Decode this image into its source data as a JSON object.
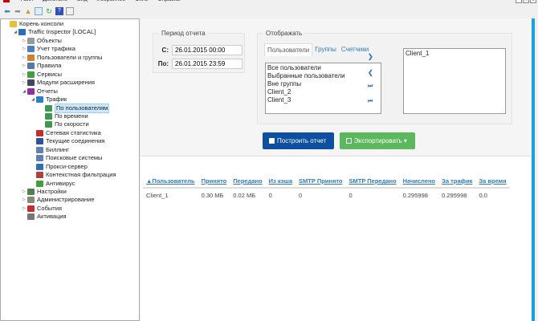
{
  "menu": [
    "Файл",
    "Действие",
    "Вид",
    "Избранное",
    "Окно",
    "Справка"
  ],
  "tree": [
    {
      "label": "Корень консоли",
      "level": 0,
      "arrow": "",
      "color": "#e8c040"
    },
    {
      "label": "Traffic Inspector [LOCAL]",
      "level": 1,
      "arrow": "◢",
      "color": "#2a6fb8"
    },
    {
      "label": "Объекты",
      "level": 2,
      "arrow": "▷",
      "color": "#999"
    },
    {
      "label": "Учет трафика",
      "level": 2,
      "arrow": "▷",
      "color": "#4a7fc0"
    },
    {
      "label": "Пользователи и группы",
      "level": 2,
      "arrow": "▷",
      "color": "#d08030"
    },
    {
      "label": "Правила",
      "level": 2,
      "arrow": "▷",
      "color": "#5577aa"
    },
    {
      "label": "Сервисы",
      "level": 2,
      "arrow": "▷",
      "color": "#40a040"
    },
    {
      "label": "Модули расширения",
      "level": 2,
      "arrow": "▷",
      "color": "#446"
    },
    {
      "label": "Отчеты",
      "level": 2,
      "arrow": "◢",
      "color": "#9030a0"
    },
    {
      "label": "Трафик",
      "level": 3,
      "arrow": "◢",
      "color": "#2a80c8"
    },
    {
      "label": "По пользователям",
      "level": 4,
      "arrow": "",
      "color": "#3a9a50",
      "selected": true
    },
    {
      "label": "По времени",
      "level": 4,
      "arrow": "",
      "color": "#3a9a50"
    },
    {
      "label": "По скорости",
      "level": 4,
      "arrow": "",
      "color": "#3a9a50"
    },
    {
      "label": "Сетевая статистика",
      "level": 3,
      "arrow": "",
      "color": "#c03030"
    },
    {
      "label": "Текущие соединения",
      "level": 3,
      "arrow": "",
      "color": "#3050a0"
    },
    {
      "label": "Биллинг",
      "level": 3,
      "arrow": "",
      "color": "#6080b0"
    },
    {
      "label": "Поисковые системы",
      "level": 3,
      "arrow": "",
      "color": "#6080b0"
    },
    {
      "label": "Прокси-сервер",
      "level": 3,
      "arrow": "",
      "color": "#3070b0"
    },
    {
      "label": "Контекстная фильтрация",
      "level": 3,
      "arrow": "",
      "color": "#b04040"
    },
    {
      "label": "Антивирус",
      "level": 3,
      "arrow": "",
      "color": "#40a040"
    },
    {
      "label": "Настройки",
      "level": 2,
      "arrow": "▷",
      "color": "#508050"
    },
    {
      "label": "Администрирование",
      "level": 2,
      "arrow": "▷",
      "color": "#887"
    },
    {
      "label": "События",
      "level": 2,
      "arrow": "▷",
      "color": "#c03030"
    },
    {
      "label": "Активация",
      "level": 2,
      "arrow": "",
      "color": "#777"
    }
  ],
  "period": {
    "legend": "Период отчета",
    "from_label": "С:",
    "from": "26.01.2015 00:00",
    "to_label": "По:",
    "to": "26.01.2015 23:59"
  },
  "display": {
    "legend": "Отображать",
    "tabs": [
      "Пользователи",
      "Группы",
      "Счетчики"
    ],
    "available": [
      "Все пользователи",
      "Выбранные пользователи",
      "Вне группы",
      "Client_2",
      "Client_3"
    ],
    "selected": [
      "Client_1"
    ]
  },
  "buttons": {
    "build": "Построить отчет",
    "export": "Экспортировать ▾"
  },
  "colors": {
    "build": "#0d4fa0",
    "export": "#5cb85c",
    "accent": "#1ba1e2"
  },
  "table": {
    "headers": [
      "▲Пользователь",
      "Принято",
      "Передано",
      "Из кэша",
      "SMTP Принято",
      "SMTP Передано",
      "Начислено",
      "За трафик",
      "За время"
    ],
    "rows": [
      [
        "Client_1",
        "0.30 МБ",
        "0.02 МБ",
        "0",
        "0",
        "0",
        "0.295998",
        "0.295998",
        "0.0"
      ]
    ]
  }
}
